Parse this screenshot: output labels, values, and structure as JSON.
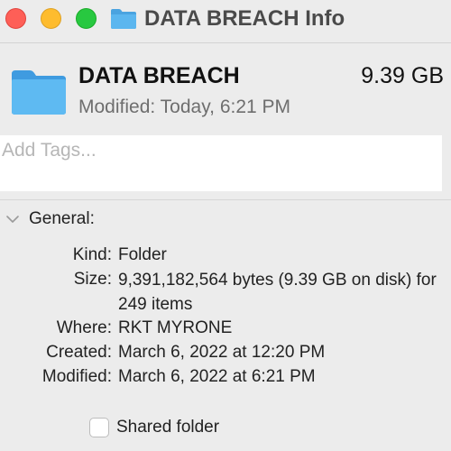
{
  "window": {
    "title": "DATA BREACH Info",
    "icon": "folder-icon"
  },
  "header": {
    "name": "DATA BREACH",
    "size": "9.39 GB",
    "modified": "Modified: Today, 6:21 PM",
    "icon": "folder-icon"
  },
  "tags": {
    "placeholder": "Add Tags...",
    "value": ""
  },
  "general": {
    "title": "General:",
    "expanded": true,
    "rows": [
      {
        "label": "Kind:",
        "value": "Folder"
      },
      {
        "label": "Size:",
        "value": "9,391,182,564 bytes (9.39 GB on disk) for 249 items"
      },
      {
        "label": "Where:",
        "value": "RKT MYRONE"
      },
      {
        "label": "Created:",
        "value": "March 6, 2022 at 12:20 PM"
      },
      {
        "label": "Modified:",
        "value": "March 6, 2022 at 6:21 PM"
      }
    ],
    "shared_folder": {
      "label": "Shared folder",
      "checked": false
    }
  },
  "colors": {
    "close": "#fe5f57",
    "minimize": "#febc2e",
    "zoom": "#28c840",
    "folder_blue": "#5ab7f0"
  }
}
